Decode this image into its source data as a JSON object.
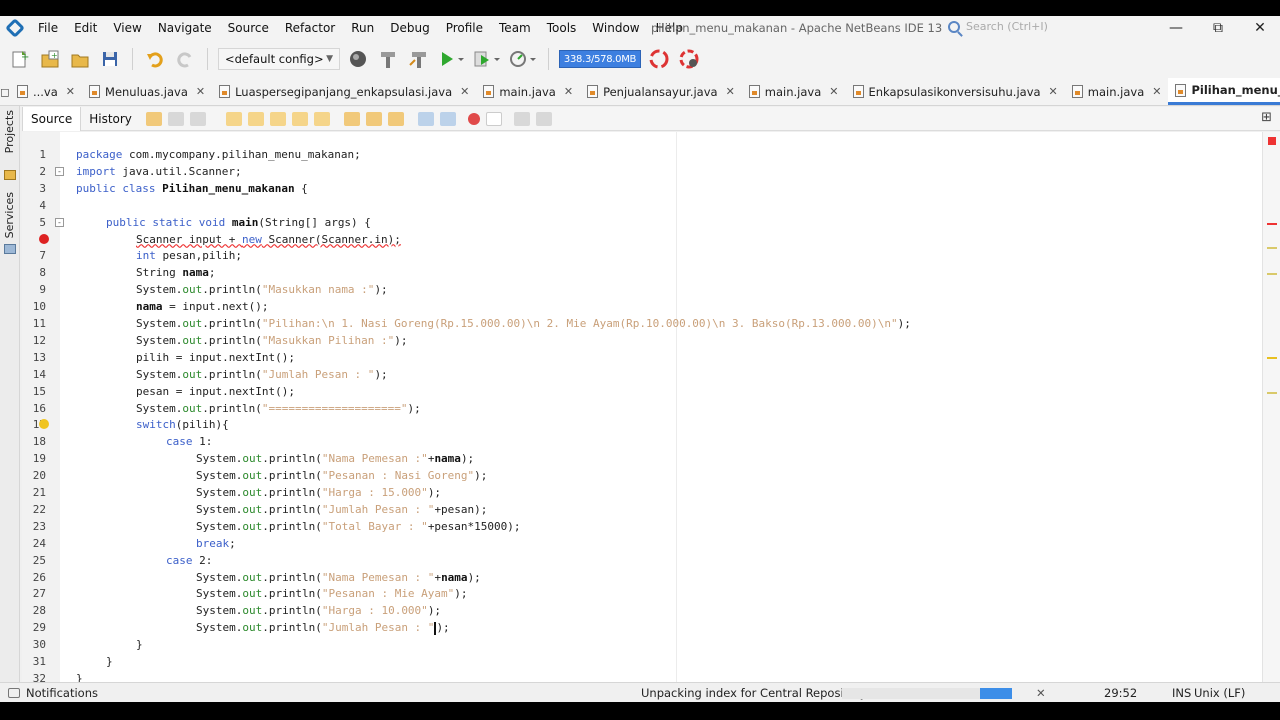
{
  "window": {
    "title": "pilihan_menu_makanan - Apache NetBeans IDE 13",
    "search_placeholder": "Search (Ctrl+I)"
  },
  "menu": [
    "File",
    "Edit",
    "View",
    "Navigate",
    "Source",
    "Refactor",
    "Run",
    "Debug",
    "Profile",
    "Team",
    "Tools",
    "Window",
    "Help"
  ],
  "toolbar": {
    "config": "<default config>",
    "memory": "338.3/578.0MB"
  },
  "tabs": [
    {
      "label": "...va",
      "active": false
    },
    {
      "label": "Menuluas.java",
      "active": false
    },
    {
      "label": "Luaspersegipanjang_enkapsulasi.java",
      "active": false
    },
    {
      "label": "main.java",
      "active": false
    },
    {
      "label": "Penjualansayur.java",
      "active": false
    },
    {
      "label": "main.java",
      "active": false
    },
    {
      "label": "Enkapsulasikonversisuhu.java",
      "active": false
    },
    {
      "label": "main.java",
      "active": false
    },
    {
      "label": "Pilihan_menu_makanan.java",
      "active": true
    }
  ],
  "side_tabs": [
    "Projects",
    "Services"
  ],
  "editor": {
    "source_tab": "Source",
    "history_tab": "History"
  },
  "code": [
    {
      "n": "1",
      "indent": 0,
      "parts": [
        [
          "kw",
          "package"
        ],
        [
          "p",
          " com.mycompany.pilihan_menu_makanan;"
        ]
      ]
    },
    {
      "n": "2",
      "indent": 0,
      "fold": "-",
      "parts": [
        [
          "kw",
          "import"
        ],
        [
          "p",
          " java.util.Scanner;"
        ]
      ]
    },
    {
      "n": "3",
      "indent": 0,
      "parts": [
        [
          "kw",
          "public class"
        ],
        [
          "p",
          " "
        ],
        [
          "b",
          "Pilihan_menu_makanan"
        ],
        [
          "p",
          " {"
        ]
      ]
    },
    {
      "n": "4",
      "indent": 0,
      "parts": []
    },
    {
      "n": "5",
      "indent": 4,
      "fold": "-",
      "parts": [
        [
          "kw",
          "public static void"
        ],
        [
          "p",
          " "
        ],
        [
          "b",
          "main"
        ],
        [
          "p",
          "(String[] args) {"
        ]
      ]
    },
    {
      "n": "6",
      "indent": 8,
      "error": true,
      "parts": [
        [
          "err",
          "Scanner input + "
        ],
        [
          "kwerr",
          "new"
        ],
        [
          "err",
          " Scanner(Scanner.in);"
        ]
      ]
    },
    {
      "n": "7",
      "indent": 8,
      "parts": [
        [
          "kw",
          "int"
        ],
        [
          "p",
          " pesan,pilih;"
        ]
      ]
    },
    {
      "n": "8",
      "indent": 8,
      "parts": [
        [
          "p",
          "String "
        ],
        [
          "b",
          "nama"
        ],
        [
          "p",
          ";"
        ]
      ]
    },
    {
      "n": "9",
      "indent": 8,
      "parts": [
        [
          "p",
          "System."
        ],
        [
          "f",
          "out"
        ],
        [
          "p",
          ".println("
        ],
        [
          "s",
          "\"Masukkan nama :\""
        ],
        [
          "p",
          ");"
        ]
      ]
    },
    {
      "n": "10",
      "indent": 8,
      "parts": [
        [
          "b",
          "nama"
        ],
        [
          "p",
          " = input.next();"
        ]
      ]
    },
    {
      "n": "11",
      "indent": 8,
      "parts": [
        [
          "p",
          "System."
        ],
        [
          "f",
          "out"
        ],
        [
          "p",
          ".println("
        ],
        [
          "s",
          "\"Pilihan:\\n 1. Nasi Goreng(Rp.15.000.00)\\n 2. Mie Ayam(Rp.10.000.00)\\n 3. Bakso(Rp.13.000.00)\\n\""
        ],
        [
          "p",
          ");"
        ]
      ]
    },
    {
      "n": "12",
      "indent": 8,
      "parts": [
        [
          "p",
          "System."
        ],
        [
          "f",
          "out"
        ],
        [
          "p",
          ".println("
        ],
        [
          "s",
          "\"Masukkan Pilihan :\""
        ],
        [
          "p",
          ");"
        ]
      ]
    },
    {
      "n": "13",
      "indent": 8,
      "parts": [
        [
          "p",
          "pilih = input.nextInt();"
        ]
      ]
    },
    {
      "n": "14",
      "indent": 8,
      "parts": [
        [
          "p",
          "System."
        ],
        [
          "f",
          "out"
        ],
        [
          "p",
          ".println("
        ],
        [
          "s",
          "\"Jumlah Pesan : \""
        ],
        [
          "p",
          ");"
        ]
      ]
    },
    {
      "n": "15",
      "indent": 8,
      "parts": [
        [
          "p",
          "pesan = input.nextInt();"
        ]
      ]
    },
    {
      "n": "16",
      "indent": 8,
      "parts": [
        [
          "p",
          "System."
        ],
        [
          "f",
          "out"
        ],
        [
          "p",
          ".println("
        ],
        [
          "s",
          "\"====================\""
        ],
        [
          "p",
          ");"
        ]
      ]
    },
    {
      "n": "17",
      "indent": 8,
      "hint": true,
      "parts": [
        [
          "kw",
          "switch"
        ],
        [
          "p",
          "(pilih){"
        ]
      ]
    },
    {
      "n": "18",
      "indent": 12,
      "parts": [
        [
          "kw",
          "case"
        ],
        [
          "p",
          " 1:"
        ]
      ]
    },
    {
      "n": "19",
      "indent": 16,
      "parts": [
        [
          "p",
          "System."
        ],
        [
          "f",
          "out"
        ],
        [
          "p",
          ".println("
        ],
        [
          "s",
          "\"Nama Pemesan :\""
        ],
        [
          "p",
          "+"
        ],
        [
          "b",
          "nama"
        ],
        [
          "p",
          ");"
        ]
      ]
    },
    {
      "n": "20",
      "indent": 16,
      "parts": [
        [
          "p",
          "System."
        ],
        [
          "f",
          "out"
        ],
        [
          "p",
          ".println("
        ],
        [
          "s",
          "\"Pesanan : Nasi Goreng\""
        ],
        [
          "p",
          ");"
        ]
      ]
    },
    {
      "n": "21",
      "indent": 16,
      "parts": [
        [
          "p",
          "System."
        ],
        [
          "f",
          "out"
        ],
        [
          "p",
          ".println("
        ],
        [
          "s",
          "\"Harga : 15.000\""
        ],
        [
          "p",
          ");"
        ]
      ]
    },
    {
      "n": "22",
      "indent": 16,
      "parts": [
        [
          "p",
          "System."
        ],
        [
          "f",
          "out"
        ],
        [
          "p",
          ".println("
        ],
        [
          "s",
          "\"Jumlah Pesan : \""
        ],
        [
          "p",
          "+pesan);"
        ]
      ]
    },
    {
      "n": "23",
      "indent": 16,
      "parts": [
        [
          "p",
          "System."
        ],
        [
          "f",
          "out"
        ],
        [
          "p",
          ".println("
        ],
        [
          "s",
          "\"Total Bayar : \""
        ],
        [
          "p",
          "+pesan*15000);"
        ]
      ]
    },
    {
      "n": "24",
      "indent": 16,
      "parts": [
        [
          "kw",
          "break"
        ],
        [
          "p",
          ";"
        ]
      ]
    },
    {
      "n": "25",
      "indent": 12,
      "parts": [
        [
          "kw",
          "case"
        ],
        [
          "p",
          " 2:"
        ]
      ]
    },
    {
      "n": "26",
      "indent": 16,
      "parts": [
        [
          "p",
          "System."
        ],
        [
          "f",
          "out"
        ],
        [
          "p",
          ".println("
        ],
        [
          "s",
          "\"Nama Pemesan : \""
        ],
        [
          "p",
          "+"
        ],
        [
          "b",
          "nama"
        ],
        [
          "p",
          ");"
        ]
      ]
    },
    {
      "n": "27",
      "indent": 16,
      "parts": [
        [
          "p",
          "System."
        ],
        [
          "f",
          "out"
        ],
        [
          "p",
          ".println("
        ],
        [
          "s",
          "\"Pesanan : Mie Ayam\""
        ],
        [
          "p",
          ");"
        ]
      ]
    },
    {
      "n": "28",
      "indent": 16,
      "parts": [
        [
          "p",
          "System."
        ],
        [
          "f",
          "out"
        ],
        [
          "p",
          ".println("
        ],
        [
          "s",
          "\"Harga : 10.000\""
        ],
        [
          "p",
          ");"
        ]
      ]
    },
    {
      "n": "29",
      "indent": 16,
      "cursor": true,
      "parts": [
        [
          "p",
          "System."
        ],
        [
          "f",
          "out"
        ],
        [
          "p",
          ".println("
        ],
        [
          "s",
          "\"Jumlah Pesan : \""
        ],
        [
          "cur",
          ""
        ],
        [
          "p",
          ");"
        ]
      ]
    },
    {
      "n": "30",
      "indent": 8,
      "parts": [
        [
          "p",
          "}"
        ]
      ]
    },
    {
      "n": "31",
      "indent": 4,
      "parts": [
        [
          "p",
          "}"
        ]
      ]
    },
    {
      "n": "32",
      "indent": 0,
      "parts": [
        [
          "p",
          "}"
        ]
      ]
    }
  ],
  "status": {
    "notifications": "Notifications",
    "task": "Unpacking index for Central Repository",
    "progress_fraction": 0.19,
    "position": "29:52",
    "mode": "INS",
    "line_endings": "Unix (LF)"
  },
  "colors": {
    "accent": "#3a7bd5",
    "keyword": "#3b5fc9",
    "string": "#c9a07a",
    "field": "#2d8a2d",
    "error": "#e33333"
  }
}
